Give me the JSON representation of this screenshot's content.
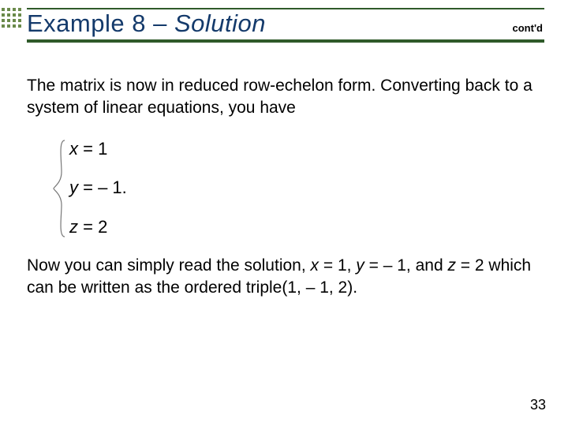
{
  "header": {
    "title_prefix": "Example 8 – ",
    "title_emph": "Solution",
    "contd": "cont'd"
  },
  "body": {
    "para1": "The matrix is now in reduced row-echelon form. Converting back to a system of linear equations, you have",
    "equations": {
      "x_lhs": "x",
      "x_rhs": "= 1",
      "y_lhs": "y",
      "y_rhs": "= – 1.",
      "z_lhs": "z",
      "z_rhs": "= 2"
    },
    "para2_a": "Now you can simply read the solution, ",
    "para2_x": "x",
    "para2_b": " = 1, ",
    "para2_y": "y",
    "para2_c": " = – 1, and ",
    "para2_z": "z",
    "para2_d": " = 2 which can be written as the ordered triple(1, – 1, 2)."
  },
  "page_number": "33"
}
